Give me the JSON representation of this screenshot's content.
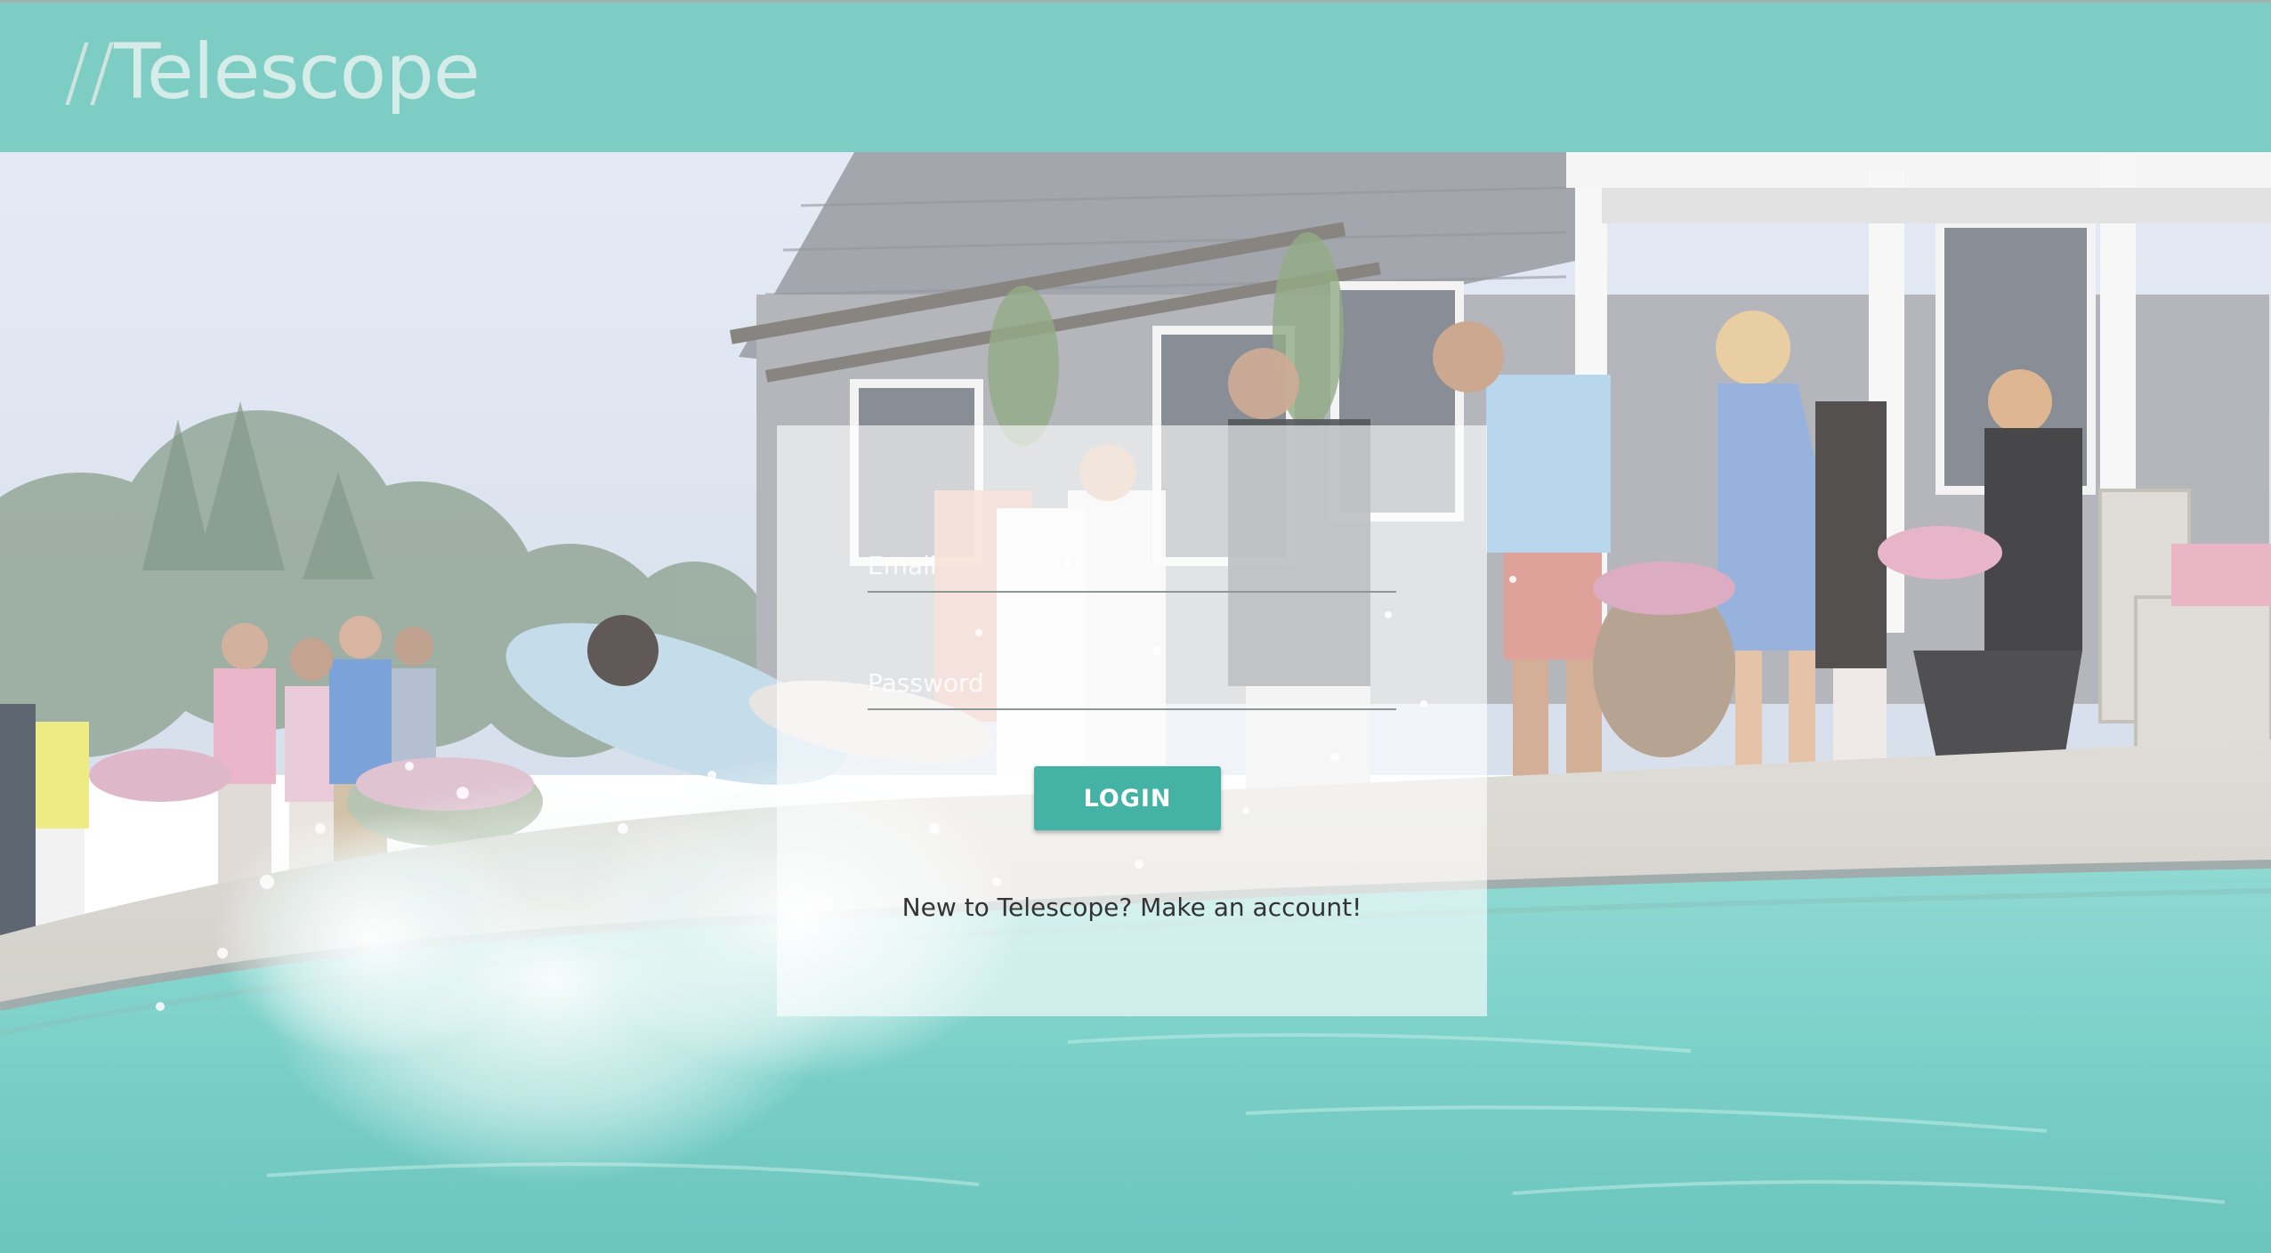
{
  "header": {
    "brand_prefix": "//",
    "brand_name": "Telescope"
  },
  "login": {
    "email_placeholder": "Email",
    "password_placeholder": "Password",
    "login_label": "LOGIN",
    "signup_text": "New to Telescope? Make an account!"
  },
  "colors": {
    "header_bg": "#7ecdc4",
    "brand_text": "#d6ece8",
    "button_bg": "#45b2a6",
    "button_text": "#ffffff",
    "pool_water": "#5ec6bd"
  }
}
